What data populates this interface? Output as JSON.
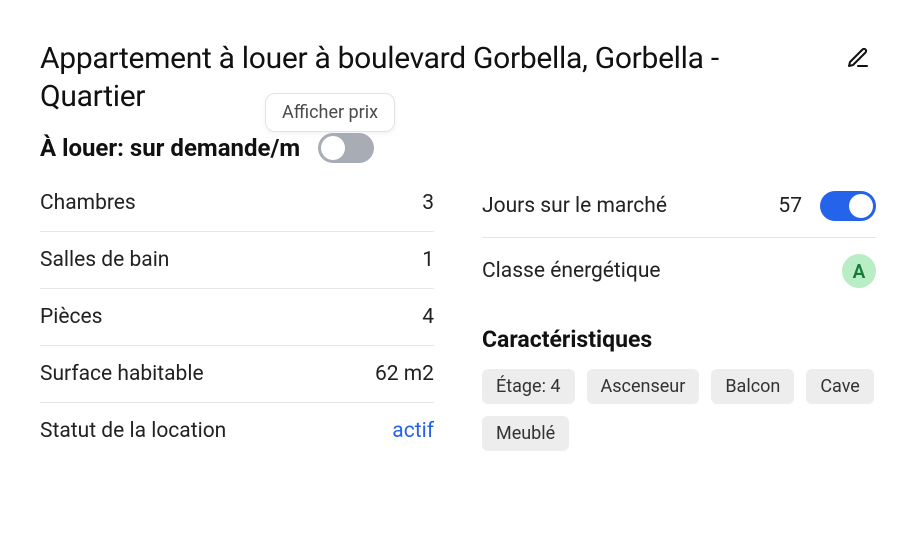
{
  "title": "Appartement à louer à boulevard Gorbella, Gorbella - Quartier",
  "tooltip_price": "Afficher prix",
  "price_label": "À louer: sur demande/m",
  "price_toggle_on": false,
  "left": {
    "bedrooms": {
      "label": "Chambres",
      "value": "3"
    },
    "bathrooms": {
      "label": "Salles de bain",
      "value": "1"
    },
    "rooms": {
      "label": "Pièces",
      "value": "4"
    },
    "area": {
      "label": "Surface habitable",
      "value": "62 m2"
    },
    "status": {
      "label": "Statut de la location",
      "value": "actif"
    }
  },
  "right": {
    "days_on_market": {
      "label": "Jours sur le marché",
      "value": "57",
      "toggle_on": true
    },
    "energy_class": {
      "label": "Classe énergétique",
      "value": "A"
    },
    "features_heading": "Caractéristiques",
    "features": [
      "Étage: 4",
      "Ascenseur",
      "Balcon",
      "Cave",
      "Meublé"
    ]
  }
}
